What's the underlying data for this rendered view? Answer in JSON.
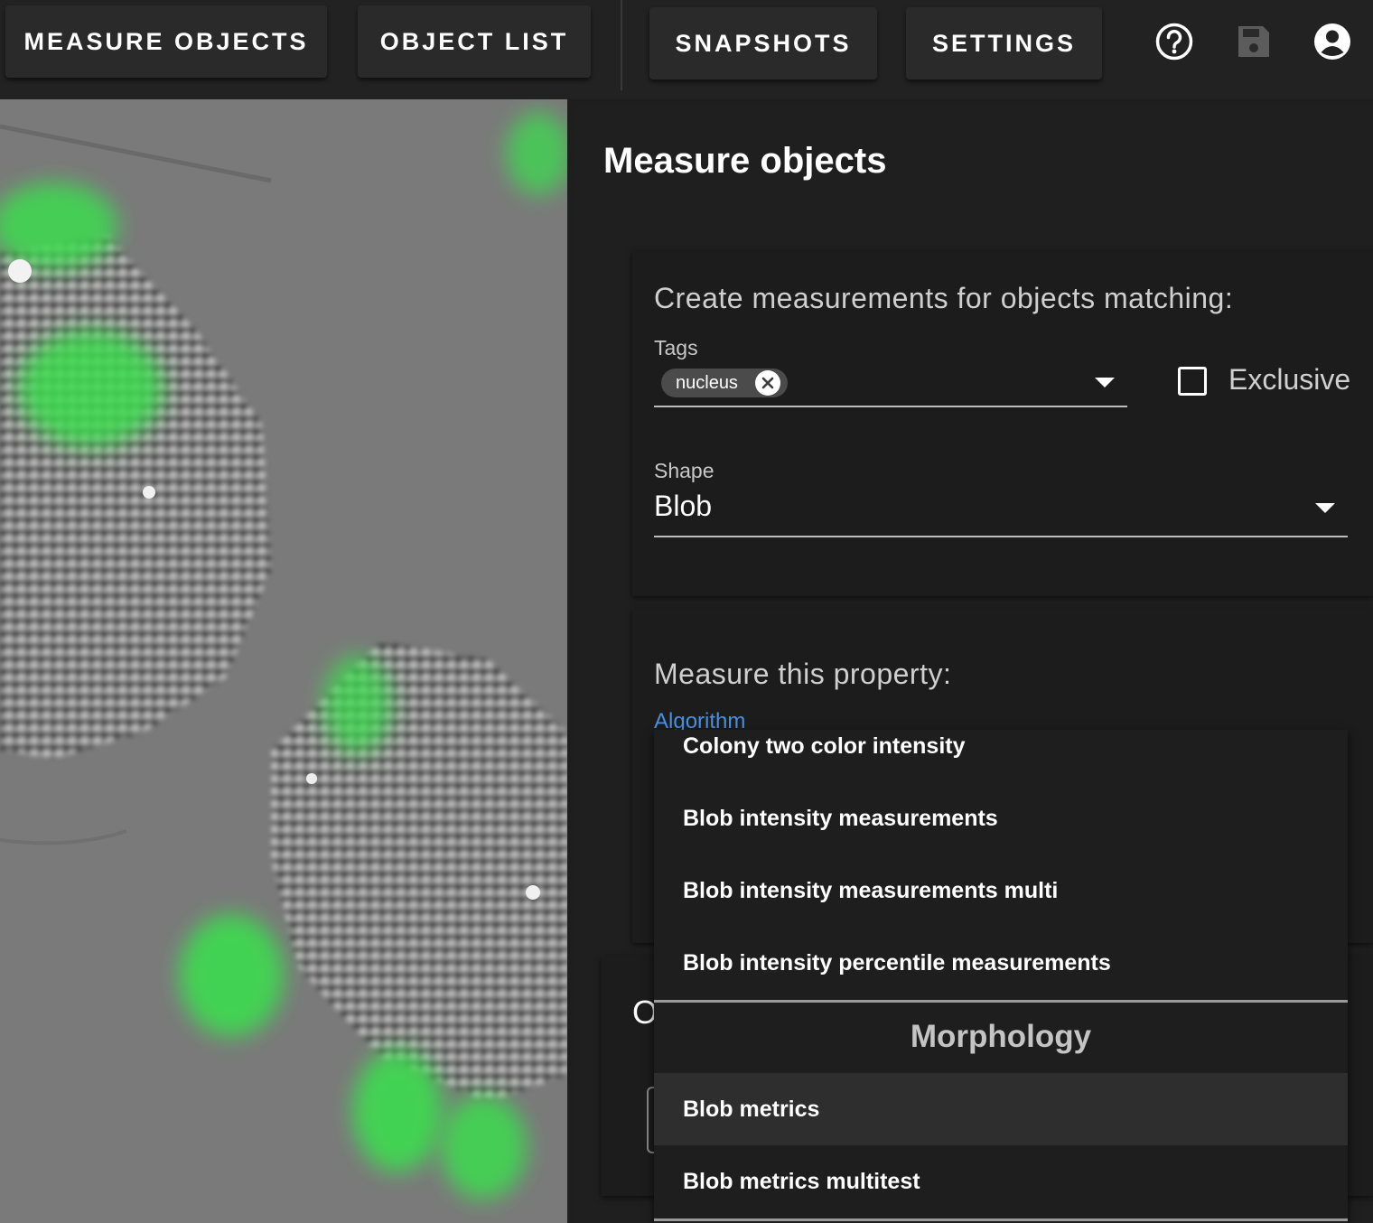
{
  "toolbar": {
    "tabs": [
      "MEASURE OBJECTS",
      "OBJECT LIST",
      "SNAPSHOTS",
      "SETTINGS"
    ],
    "icons": [
      "help-icon",
      "save-icon",
      "account-icon"
    ]
  },
  "panel": {
    "title": "Measure objects",
    "match_heading": "Create measurements for objects matching:",
    "tags_label": "Tags",
    "tag_chips": [
      "nucleus"
    ],
    "exclusive_label": "Exclusive",
    "exclusive_checked": false,
    "shape_label": "Shape",
    "shape_value": "Blob",
    "property_heading": "Measure this property:",
    "algorithm_label": "Algorithm",
    "partial_char": "O"
  },
  "menu": {
    "items_top": [
      "Colony two color intensity",
      "Blob intensity measurements",
      "Blob intensity measurements multi",
      "Blob intensity percentile measurements"
    ],
    "group_header": "Morphology",
    "items_bottom": [
      "Blob metrics",
      "Blob metrics multitest"
    ],
    "selected": "Blob metrics"
  },
  "colors": {
    "accent_link": "#4a90e2",
    "fluorescence": "#3ddc4f",
    "background": "#1e1e1e"
  }
}
